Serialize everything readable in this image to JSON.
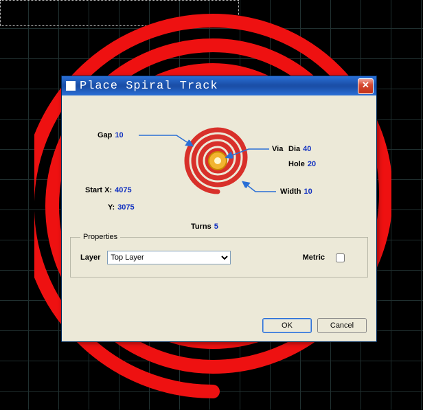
{
  "dialog": {
    "title": "Place Spiral Track",
    "params": {
      "gap": {
        "label": "Gap",
        "value": "10"
      },
      "startx": {
        "label": "Start X:",
        "value": "4075"
      },
      "starty": {
        "label": "Y:",
        "value": "3075"
      },
      "turns": {
        "label": "Turns",
        "value": "5"
      },
      "via": {
        "label": "Via",
        "value": ""
      },
      "dia": {
        "label": "Dia",
        "value": "40"
      },
      "hole": {
        "label": "Hole",
        "value": "20"
      },
      "width": {
        "label": "Width",
        "value": "10"
      }
    },
    "properties": {
      "legend": "Properties",
      "layer_label": "Layer",
      "layer_selected": "Top Layer",
      "metric_label": "Metric",
      "metric_checked": false
    },
    "buttons": {
      "ok": "OK",
      "cancel": "Cancel"
    }
  }
}
